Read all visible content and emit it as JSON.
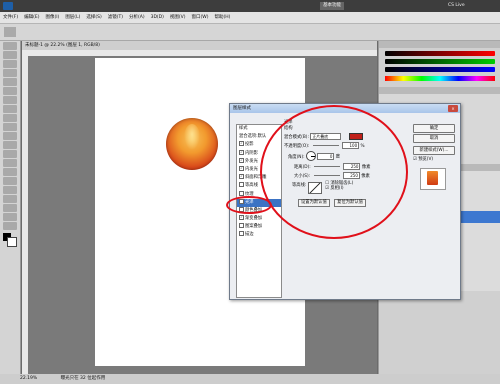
{
  "menubar": {
    "items": [
      "文件(F)",
      "编辑(E)",
      "图像(I)",
      "图层(L)",
      "选择(S)",
      "滤镜(T)",
      "分析(A)",
      "3D(D)",
      "视图(V)",
      "窗口(W)",
      "帮助(H)"
    ]
  },
  "appbar": {
    "workspace_label": "基本功能",
    "cslive": "CS Live"
  },
  "document": {
    "tab_label": "未标题-1 @ 22.2% (图层 1, RGB/8)",
    "zoom": "22.19%",
    "status": "曝光只在 32 位起作用"
  },
  "dialog": {
    "title": "图层样式",
    "close": "×",
    "styles": [
      {
        "label": "样式",
        "checked": null
      },
      {
        "label": "混合选项:默认",
        "checked": null
      },
      {
        "label": "投影",
        "checked": true
      },
      {
        "label": "内阴影",
        "checked": true
      },
      {
        "label": "外发光",
        "checked": true
      },
      {
        "label": "内发光",
        "checked": true
      },
      {
        "label": "斜面和浮雕",
        "checked": true
      },
      {
        "label": "等高线",
        "checked": false
      },
      {
        "label": "纹理",
        "checked": false
      },
      {
        "label": "光泽",
        "checked": true
      },
      {
        "label": "颜色叠加",
        "checked": false
      },
      {
        "label": "渐变叠加",
        "checked": true
      },
      {
        "label": "图案叠加",
        "checked": false
      },
      {
        "label": "描边",
        "checked": false
      }
    ],
    "section_title": "光泽",
    "section_sub": "结构",
    "blend_mode_label": "混合模式(B):",
    "blend_mode_value": "正片叠底",
    "opacity_label": "不透明度(O):",
    "opacity_value": "100",
    "opacity_unit": "%",
    "angle_label": "角度(N):",
    "angle_value": "0",
    "angle_unit": "度",
    "distance_label": "距离(D):",
    "distance_value": "250",
    "distance_unit": "像素",
    "size_label": "大小(S):",
    "size_value": "250",
    "size_unit": "像素",
    "contour_label": "等高线:",
    "antialias_label": "消除锯齿(L)",
    "invert_label": "反相(I)",
    "make_default": "设置为默认值",
    "reset_default": "复位为默认值",
    "ok": "确定",
    "cancel": "取消",
    "new_style": "新建样式(W)...",
    "preview_label": "预览(V)",
    "accent_color": "#c0201a"
  },
  "icons": [
    "close-icon",
    "move-tool-icon",
    "marquee-tool-icon",
    "lasso-tool-icon",
    "eye-icon"
  ]
}
